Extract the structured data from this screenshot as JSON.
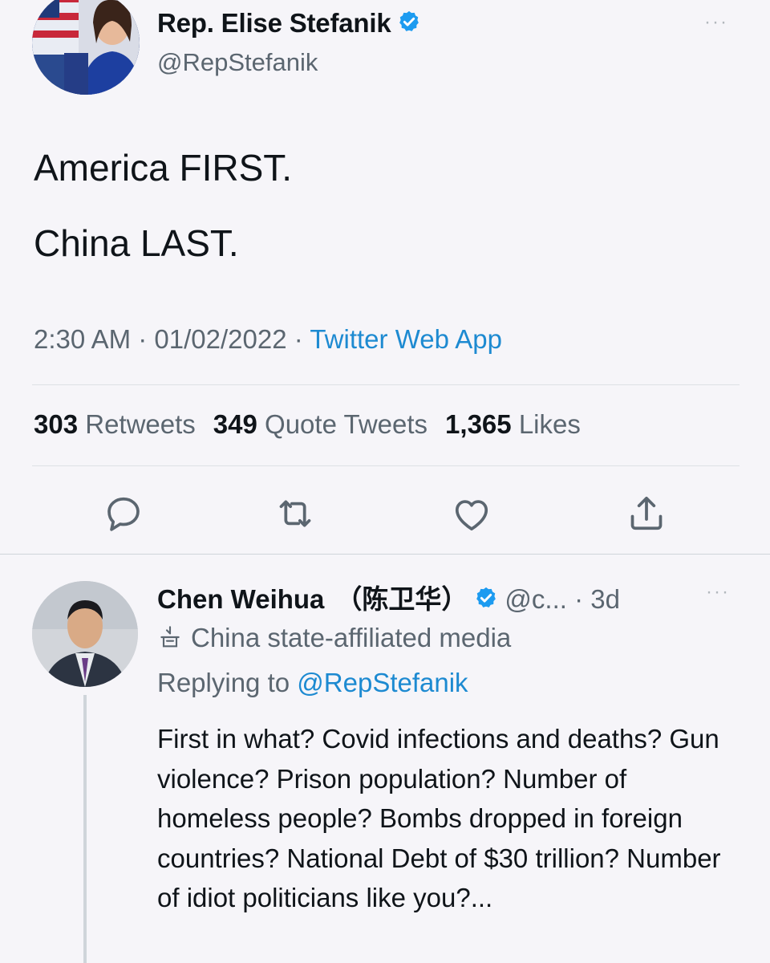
{
  "main_tweet": {
    "author_name": "Rep. Elise Stefanik",
    "handle": "@RepStefanik",
    "more": "···",
    "text_lines": [
      "America FIRST.",
      "China LAST."
    ],
    "time": "2:30 AM",
    "date": "01/02/2022",
    "separator": "·",
    "source": "Twitter Web App",
    "stats": {
      "retweets_count": "303",
      "retweets_label": "Retweets",
      "quotes_count": "349",
      "quotes_label": "Quote Tweets",
      "likes_count": "1,365",
      "likes_label": "Likes"
    },
    "actions": [
      "reply-icon",
      "retweet-icon",
      "like-icon",
      "share-icon"
    ]
  },
  "reply": {
    "author_name": "Chen Weihua",
    "author_name_cn": "（陈卫华）",
    "handle": "@c...",
    "time_sep": " · ",
    "time": "3d",
    "more": "···",
    "label": "China state-affiliated media",
    "replying_prefix": "Replying to",
    "replying_to": "@RepStefanik",
    "text": "First in what? Covid infections and deaths? Gun violence? Prison population? Number of homeless people? Bombs dropped in foreign countries? National Debt of $30 trillion? Number of idiot politicians like you?..."
  },
  "colors": {
    "background": "#f6f5f9",
    "text": "#0f1419",
    "secondary_text": "#5b6670",
    "link": "#1d8ad1",
    "verified": "#1d9bf0",
    "divider": "#dde1e5"
  }
}
